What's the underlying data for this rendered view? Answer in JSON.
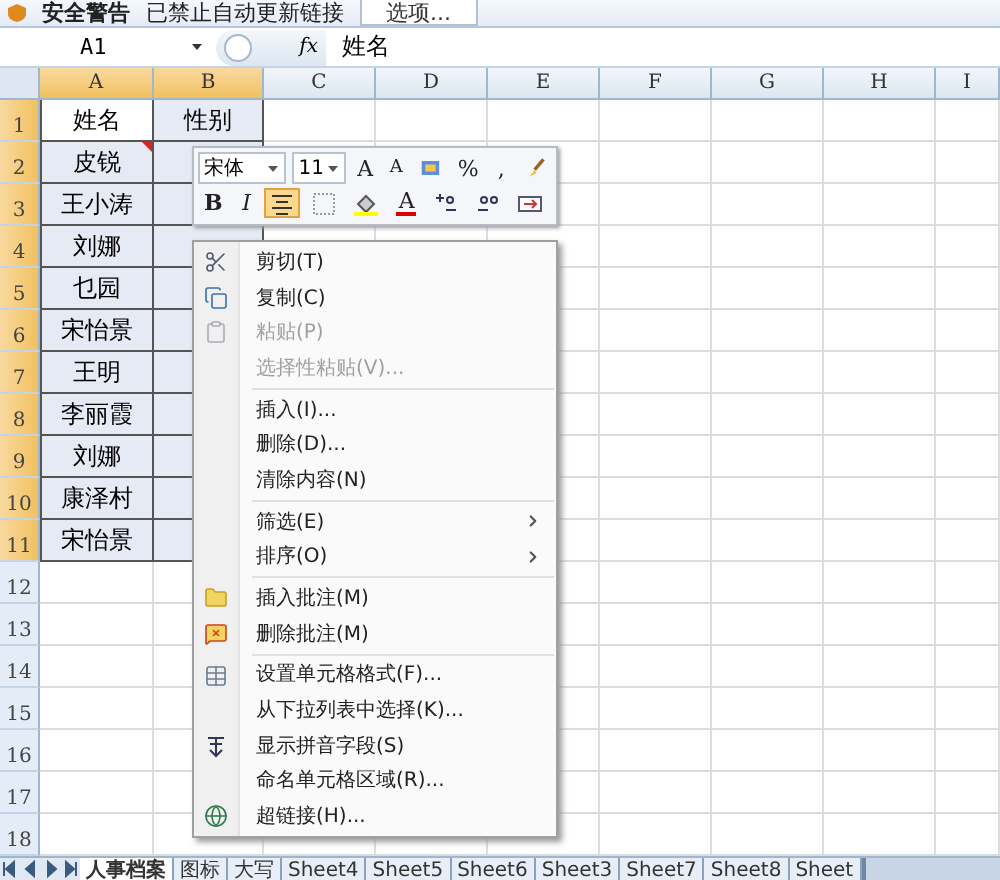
{
  "security_bar": {
    "title": "安全警告",
    "message": "已禁止自动更新链接",
    "button": "选项..."
  },
  "formula_bar": {
    "name_box": "A1",
    "formula_label": "fx",
    "value": "姓名"
  },
  "columns": [
    {
      "label": "A",
      "selected": true
    },
    {
      "label": "B",
      "selected": true
    },
    {
      "label": "C",
      "selected": false
    },
    {
      "label": "D",
      "selected": false
    },
    {
      "label": "E",
      "selected": false
    },
    {
      "label": "F",
      "selected": false
    },
    {
      "label": "G",
      "selected": false
    },
    {
      "label": "H",
      "selected": false
    },
    {
      "label": "I",
      "selected": false
    }
  ],
  "rows": [
    {
      "header": "1",
      "selected": true,
      "cells": [
        {
          "text": "姓名",
          "selected": true,
          "active": true
        },
        {
          "text": "性别",
          "selected": true,
          "active": false
        }
      ]
    },
    {
      "header": "2",
      "selected": true,
      "cells": [
        {
          "text": "皮锐",
          "selected": true,
          "active": false,
          "comment": true
        },
        {
          "selected": true,
          "active": false
        }
      ]
    },
    {
      "header": "3",
      "selected": true,
      "cells": [
        {
          "text": "王小涛",
          "selected": true,
          "active": false
        },
        {
          "selected": true,
          "active": false
        }
      ]
    },
    {
      "header": "4",
      "selected": true,
      "cells": [
        {
          "text": "刘娜",
          "selected": true,
          "active": false
        },
        {
          "selected": true,
          "active": false
        }
      ]
    },
    {
      "header": "5",
      "selected": true,
      "cells": [
        {
          "text": "乜园",
          "selected": true,
          "active": false
        },
        {
          "selected": true,
          "active": false
        }
      ]
    },
    {
      "header": "6",
      "selected": true,
      "cells": [
        {
          "text": "宋怡景",
          "selected": true,
          "active": false
        },
        {
          "selected": true,
          "active": false
        }
      ]
    },
    {
      "header": "7",
      "selected": true,
      "cells": [
        {
          "text": "王明",
          "selected": true,
          "active": false
        },
        {
          "selected": true,
          "active": false
        }
      ]
    },
    {
      "header": "8",
      "selected": true,
      "cells": [
        {
          "text": "李丽霞",
          "selected": true,
          "active": false
        },
        {
          "selected": true,
          "active": false
        }
      ]
    },
    {
      "header": "9",
      "selected": true,
      "cells": [
        {
          "text": "刘娜",
          "selected": true,
          "active": false
        },
        {
          "selected": true,
          "active": false
        }
      ]
    },
    {
      "header": "10",
      "selected": true,
      "cells": [
        {
          "text": "康泽村",
          "selected": true,
          "active": false
        },
        {
          "selected": true,
          "active": false
        }
      ]
    },
    {
      "header": "11",
      "selected": true,
      "cells": [
        {
          "text": "宋怡景",
          "selected": true,
          "active": false
        },
        {
          "selected": true,
          "active": false
        }
      ]
    },
    {
      "header": "12",
      "selected": false,
      "cells": []
    },
    {
      "header": "13",
      "selected": false,
      "cells": []
    },
    {
      "header": "14",
      "selected": false,
      "cells": []
    },
    {
      "header": "15",
      "selected": false,
      "cells": []
    },
    {
      "header": "16",
      "selected": false,
      "cells": []
    },
    {
      "header": "17",
      "selected": false,
      "cells": []
    },
    {
      "header": "18",
      "selected": false,
      "cells": []
    }
  ],
  "mini_toolbar": {
    "rows": [
      [
        {
          "kind": "select",
          "text": "宋体",
          "wide": true
        },
        {
          "kind": "select",
          "text": "11",
          "wide": false
        },
        {
          "kind": "grow",
          "text": "A"
        },
        {
          "kind": "shrink",
          "text": "A"
        },
        {
          "kind": "icon"
        },
        {
          "kind": "text",
          "text": "%"
        },
        {
          "kind": "text",
          "text": ","
        },
        {
          "kind": "icon"
        }
      ],
      [
        {
          "kind": "bold",
          "text": "B"
        },
        {
          "kind": "italic",
          "text": "I",
          "selected": false
        },
        {
          "kind": "icon",
          "selected": true
        },
        {
          "kind": "icon"
        },
        {
          "kind": "icon"
        },
        {
          "kind": "fontcolor",
          "text": "A"
        },
        {
          "kind": "icon"
        },
        {
          "kind": "icon"
        },
        {
          "kind": "icon"
        }
      ]
    ]
  },
  "context_menu": [
    {
      "kind": "item",
      "label": "剪切(T)",
      "disabled": false,
      "submenu": false
    },
    {
      "kind": "item",
      "label": "复制(C)",
      "disabled": false,
      "submenu": false
    },
    {
      "kind": "item",
      "label": "粘贴(P)",
      "disabled": true,
      "submenu": false
    },
    {
      "kind": "item",
      "label": "选择性粘贴(V)...",
      "disabled": true,
      "submenu": false
    },
    {
      "kind": "separator"
    },
    {
      "kind": "item",
      "label": "插入(I)...",
      "disabled": false,
      "submenu": false
    },
    {
      "kind": "item",
      "label": "删除(D)...",
      "disabled": false,
      "submenu": false
    },
    {
      "kind": "item",
      "label": "清除内容(N)",
      "disabled": false,
      "submenu": false
    },
    {
      "kind": "separator"
    },
    {
      "kind": "item",
      "label": "筛选(E)",
      "disabled": false,
      "submenu": true
    },
    {
      "kind": "item",
      "label": "排序(O)",
      "disabled": false,
      "submenu": true
    },
    {
      "kind": "separator"
    },
    {
      "kind": "item",
      "label": "插入批注(M)",
      "disabled": false,
      "submenu": false
    },
    {
      "kind": "item",
      "label": "删除批注(M)",
      "disabled": false,
      "submenu": false
    },
    {
      "kind": "separator"
    },
    {
      "kind": "item",
      "label": "设置单元格格式(F)...",
      "disabled": false,
      "submenu": false
    },
    {
      "kind": "item",
      "label": "从下拉列表中选择(K)...",
      "disabled": false,
      "submenu": false
    },
    {
      "kind": "item",
      "label": "显示拼音字段(S)",
      "disabled": false,
      "submenu": false
    },
    {
      "kind": "item",
      "label": "命名单元格区域(R)...",
      "disabled": false,
      "submenu": false
    },
    {
      "kind": "item",
      "label": "超链接(H)...",
      "disabled": false,
      "submenu": false
    }
  ],
  "sheet_tabs": [
    {
      "label": "人事档案",
      "selected": true
    },
    {
      "label": "图标",
      "selected": false
    },
    {
      "label": "大写",
      "selected": false
    },
    {
      "label": "Sheet4",
      "selected": false
    },
    {
      "label": "Sheet5",
      "selected": false
    },
    {
      "label": "Sheet6",
      "selected": false
    },
    {
      "label": "Sheet3",
      "selected": false
    },
    {
      "label": "Sheet7",
      "selected": false
    },
    {
      "label": "Sheet8",
      "selected": false
    },
    {
      "label": "Sheet",
      "selected": false
    }
  ]
}
